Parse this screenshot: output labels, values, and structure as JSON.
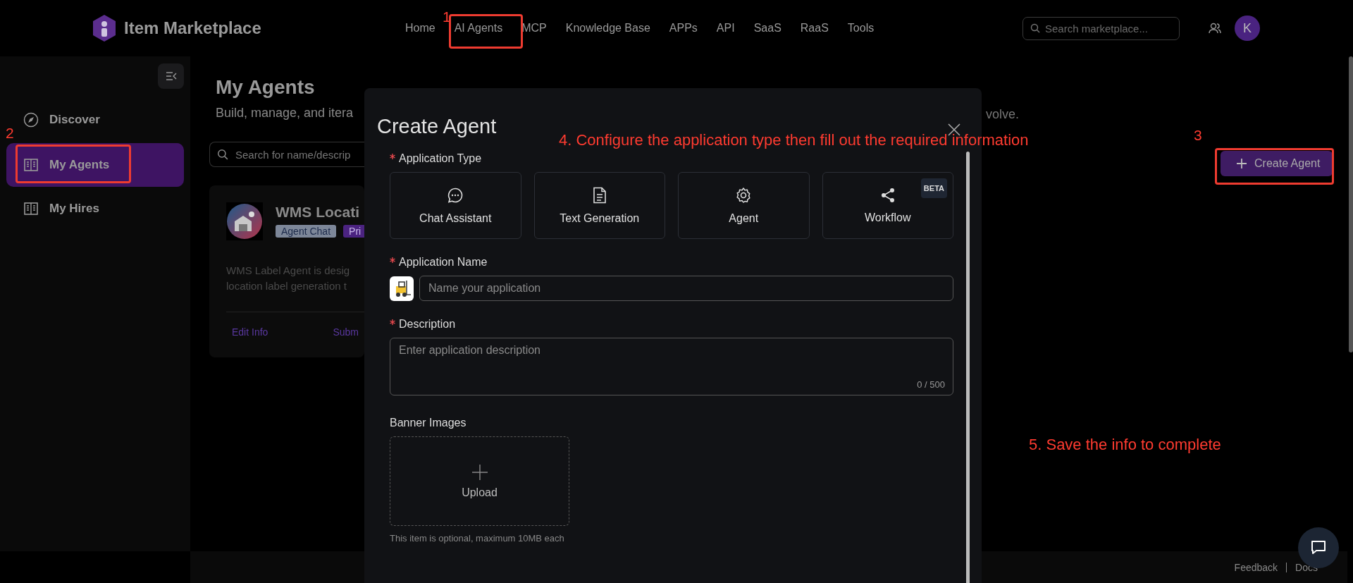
{
  "header": {
    "logo_text": "Item Marketplace",
    "nav": [
      {
        "label": "Home"
      },
      {
        "label": "AI Agents"
      },
      {
        "label": "MCP"
      },
      {
        "label": "Knowledge Base"
      },
      {
        "label": "APPs"
      },
      {
        "label": "API"
      },
      {
        "label": "SaaS"
      },
      {
        "label": "RaaS"
      },
      {
        "label": "Tools"
      }
    ],
    "search": {
      "placeholder": "Search marketplace..."
    },
    "avatar": "K"
  },
  "sidebar": {
    "items": [
      {
        "label": "Discover",
        "kind": "compass",
        "selected": false
      },
      {
        "label": "My Agents",
        "kind": "book",
        "selected": true
      },
      {
        "label": "My Hires",
        "kind": "book",
        "selected": false
      }
    ]
  },
  "page": {
    "title": "My Agents",
    "subtitle_left": "Build, manage, and itera",
    "subtitle_right": "volve.",
    "search": {
      "placeholder": "Search for name/descrip"
    },
    "create_button": "Create Agent",
    "card": {
      "title": "WMS Locati",
      "tags": [
        {
          "label": "Agent Chat",
          "color": "#7d8799"
        },
        {
          "label": "Pri",
          "color": "#4b2380"
        }
      ],
      "description": [
        "WMS Label Agent is desig",
        "location label generation t"
      ],
      "actions": [
        "Edit Info",
        "Subm"
      ]
    }
  },
  "modal": {
    "title": "Create Agent",
    "type_field": {
      "label": "Application Type",
      "required": true,
      "options": [
        {
          "label": "Chat Assistant",
          "kind": "chat"
        },
        {
          "label": "Text Generation",
          "kind": "document"
        },
        {
          "label": "Agent",
          "kind": "gear"
        },
        {
          "label": "Workflow",
          "kind": "share",
          "badge": "BETA"
        }
      ]
    },
    "name_field": {
      "label": "Application Name",
      "required": true,
      "placeholder": "Name your application"
    },
    "description_field": {
      "label": "Description",
      "required": true,
      "placeholder": "Enter application description",
      "counter": "0 / 500"
    },
    "banner_field": {
      "label": "Banner Images",
      "required": false,
      "upload": "Upload",
      "hint": "This item is optional, maximum 10MB each"
    }
  },
  "footer": {
    "links": [
      "Feedback",
      "Docs"
    ]
  },
  "annotations": {
    "markers": [
      "1",
      "2",
      "3"
    ],
    "notes": [
      "4. Configure the application type then fill out the required information",
      "5. Save the info to complete"
    ]
  }
}
